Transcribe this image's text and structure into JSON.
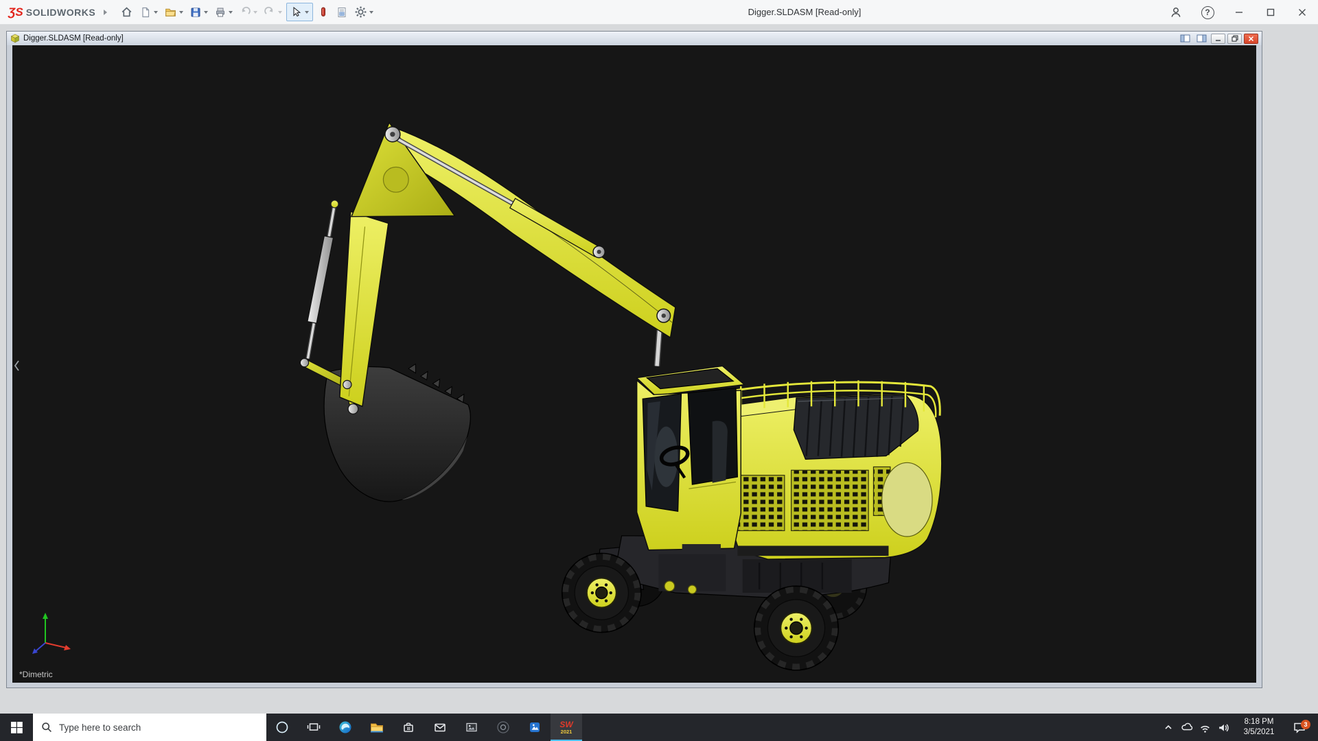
{
  "app_titlebar": {
    "logo_mark": "ƷS",
    "logo_text": "SOLIDWORKS",
    "window_title": "Digger.SLDASM [Read-only]"
  },
  "toolbar_icons": [
    {
      "name": "home-icon"
    },
    {
      "name": "new-document-icon",
      "dropdown": true
    },
    {
      "name": "open-folder-icon",
      "dropdown": true
    },
    {
      "name": "save-icon",
      "dropdown": true
    },
    {
      "name": "print-icon",
      "dropdown": true
    },
    {
      "name": "undo-icon",
      "dropdown": true,
      "disabled": true
    },
    {
      "name": "redo-icon",
      "dropdown": true,
      "disabled": true
    },
    {
      "name": "select-cursor-icon",
      "dropdown": true,
      "active": true
    },
    {
      "name": "appearance-icon"
    },
    {
      "name": "file-properties-icon"
    },
    {
      "name": "settings-gear-icon",
      "dropdown": true
    }
  ],
  "window_controls": [
    "user-account-icon",
    "help-icon",
    "minimize-icon",
    "maximize-icon",
    "close-icon"
  ],
  "icons": {
    "help_glyph": "?"
  },
  "document_window": {
    "title": "Digger.SLDASM [Read-only]",
    "controls": [
      "pane-left-icon",
      "pane-right-icon",
      "minimize-icon",
      "restore-icon",
      "close-icon"
    ],
    "view_orientation": "*Dimetric"
  },
  "viewport": {
    "background_color": "#161616",
    "model_body_color": "#dfe22a",
    "model_dark_color": "#26262a"
  },
  "taskbar": {
    "search_placeholder": "Type here to search",
    "app_icons": [
      "start-icon",
      "cortana-icon",
      "task-view-icon",
      "edge-icon",
      "file-explorer-icon",
      "store-icon",
      "mail-icon",
      "photos-icon",
      "dark-app-icon",
      "blue-app-icon",
      "solidworks-icon"
    ],
    "solidworks_label": "SW",
    "solidworks_year": "2021",
    "tray_icons": [
      "chevron-up-icon",
      "cloud-icon",
      "wifi-icon",
      "volume-icon"
    ],
    "clock_time": "8:18 PM",
    "clock_date": "3/5/2021",
    "notification_badge": "3"
  }
}
